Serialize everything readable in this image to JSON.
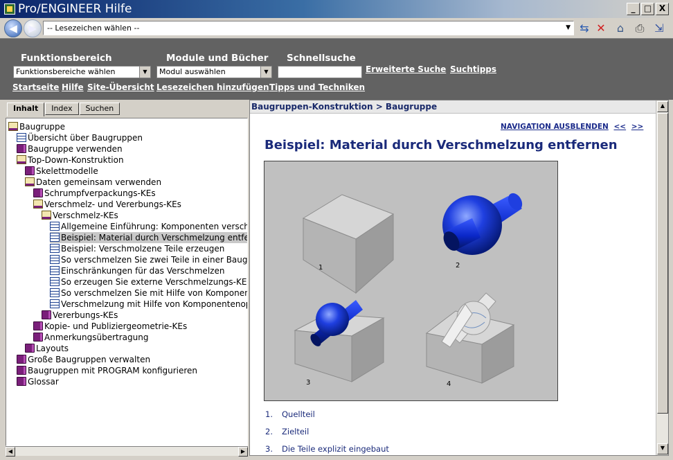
{
  "window": {
    "title": "Pro/ENGINEER Hilfe",
    "buttons": [
      "_",
      "□",
      "X"
    ]
  },
  "toolbar": {
    "back_glyph": "◀",
    "forward_glyph": "▶",
    "bookmark_select": "-- Lesezeichen wählen --",
    "icons": [
      "sync-icon",
      "stop-icon",
      "home-icon",
      "print-icon",
      "exit-icon"
    ]
  },
  "header": {
    "funktionsbereich_label": "Funktionsbereich",
    "funktionsbereich_value": "Funktionsbereiche wählen",
    "module_label": "Module und Bücher",
    "module_value": "Modul auswählen",
    "schnellsuche_label": "Schnellsuche",
    "schnellsuche_value": "",
    "erweiterte_suche": "Erweiterte Suche",
    "suchtipps": "Suchtipps",
    "links": [
      "Startseite",
      "Hilfe",
      "Site-Übersicht",
      "Lesezeichen hinzufügen",
      "Tipps und Techniken"
    ]
  },
  "tabs": [
    "Inhalt",
    "Index",
    "Suchen"
  ],
  "tree": [
    {
      "label": "Baugruppe",
      "icon": "open-book-icon"
    },
    {
      "label": "Übersicht über Baugruppen",
      "icon": "document-icon"
    },
    {
      "label": "Baugruppe verwenden",
      "icon": "book-icon"
    },
    {
      "label": "Top-Down-Konstruktion",
      "icon": "open-book-icon"
    },
    {
      "label": "Skelettmodelle",
      "icon": "book-icon"
    },
    {
      "label": "Daten gemeinsam verwenden",
      "icon": "open-book-icon"
    },
    {
      "label": "Schrumpfverpackungs-KEs",
      "icon": "book-icon"
    },
    {
      "label": "Verschmelz- und Vererbungs-KEs",
      "icon": "open-book-icon"
    },
    {
      "label": "Verschmelz-KEs",
      "icon": "open-book-icon"
    },
    {
      "label": "Allgemeine Einführung: Komponenten verschmel",
      "icon": "document-icon"
    },
    {
      "label": "Beispiel: Material durch Verschmelzung entfernen",
      "icon": "document-icon"
    },
    {
      "label": "Beispiel: Verschmolzene Teile erzeugen",
      "icon": "document-icon"
    },
    {
      "label": "So verschmelzen Sie zwei Teile in einer Baugrupp",
      "icon": "document-icon"
    },
    {
      "label": "Einschränkungen für das Verschmelzen",
      "icon": "document-icon"
    },
    {
      "label": "So erzeugen Sie externe Verschmelzungs-KEs",
      "icon": "document-icon"
    },
    {
      "label": "So verschmelzen Sie mit Hilfe von Komponente",
      "icon": "document-icon"
    },
    {
      "label": "Verschmelzung mit Hilfe von Komponentenopera",
      "icon": "document-icon"
    },
    {
      "label": "Vererbungs-KEs",
      "icon": "book-icon"
    },
    {
      "label": "Kopie- und Publiziergeometrie-KEs",
      "icon": "book-icon"
    },
    {
      "label": "Anmerkungsübertragung",
      "icon": "book-icon"
    },
    {
      "label": "Layouts",
      "icon": "book-icon"
    },
    {
      "label": "Große Baugruppen verwalten",
      "icon": "book-icon"
    },
    {
      "label": "Baugruppen mit PROGRAM konfigurieren",
      "icon": "book-icon"
    },
    {
      "label": "Glossar",
      "icon": "book-icon"
    }
  ],
  "content": {
    "breadcrumb": "Baugruppen-Konstruktion > Baugruppe",
    "nav_hide": "NAVIGATION AUSBLENDEN",
    "nav_prev": "<<",
    "nav_next": ">>",
    "title": "Beispiel: Material durch Verschmelzung entfernen",
    "figure_labels": [
      "1",
      "2",
      "3",
      "4"
    ],
    "steps": [
      {
        "num": "1.",
        "text": "Quellteil"
      },
      {
        "num": "2.",
        "text": "Zielteil"
      },
      {
        "num": "3.",
        "text": "Die Teile explizit eingebaut"
      }
    ]
  },
  "colors": {
    "header_bg": "#626262",
    "link_blue": "#1a2a7a",
    "selected_row": "#c8c8c8"
  }
}
